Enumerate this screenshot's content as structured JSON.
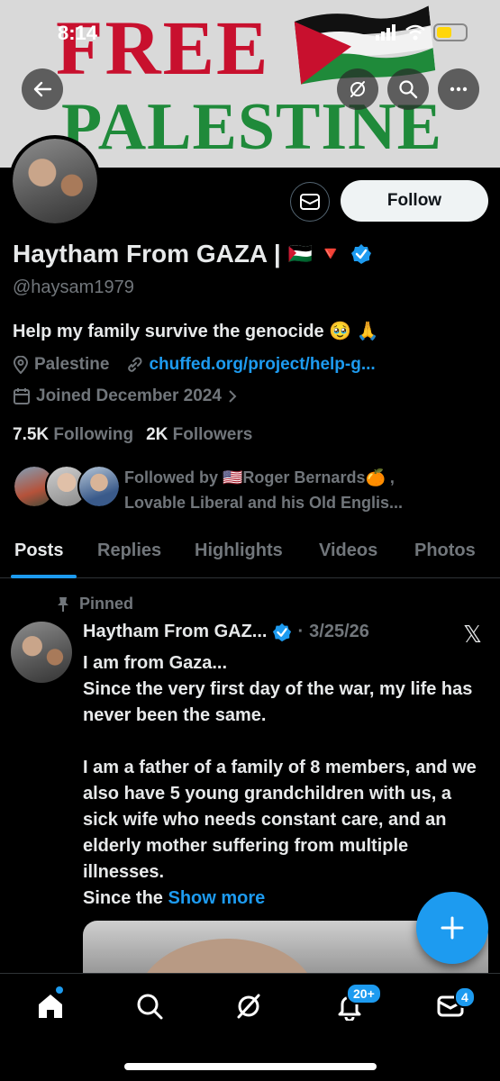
{
  "status": {
    "time": "8:14"
  },
  "banner": {
    "line1": "FREE",
    "line2": "PALESTINE"
  },
  "profile": {
    "name": "Haytham From GAZA |",
    "name_emoji": "🇵🇸 🔻",
    "handle": "@haysam1979",
    "bio": "Help my family survive the genocide 🥹 🙏",
    "location": "Palestine",
    "link": "chuffed.org/project/help-g...",
    "joined": "Joined December 2024",
    "following_count": "7.5K",
    "following_label": "Following",
    "followers_count": "2K",
    "followers_label": "Followers",
    "followed_by_line1": "Followed by 🇺🇸Roger Bernards🍊 ,",
    "followed_by_line2": "Lovable Liberal and his Old Englis...",
    "follow_label": "Follow"
  },
  "tabs": [
    {
      "label": "Posts"
    },
    {
      "label": "Replies"
    },
    {
      "label": "Highlights"
    },
    {
      "label": "Videos"
    },
    {
      "label": "Photos"
    }
  ],
  "post": {
    "pinned_label": "Pinned",
    "author": "Haytham From GAZ...",
    "date": "3/25/26",
    "lines": [
      "I am from Gaza...",
      "Since the very first day of the war, my life has never been the same.",
      "",
      "I am a father of a family of 8 members, and we also have 5 young grandchildren with us, a sick wife who needs constant care, and an elderly mother suffering from multiple illnesses."
    ],
    "last_line_start": "Since the",
    "show_more": "Show more"
  },
  "nav": {
    "notifications_badge": "20+",
    "messages_badge": "4"
  },
  "colors": {
    "accent": "#1d9bf0",
    "background": "#000000"
  }
}
